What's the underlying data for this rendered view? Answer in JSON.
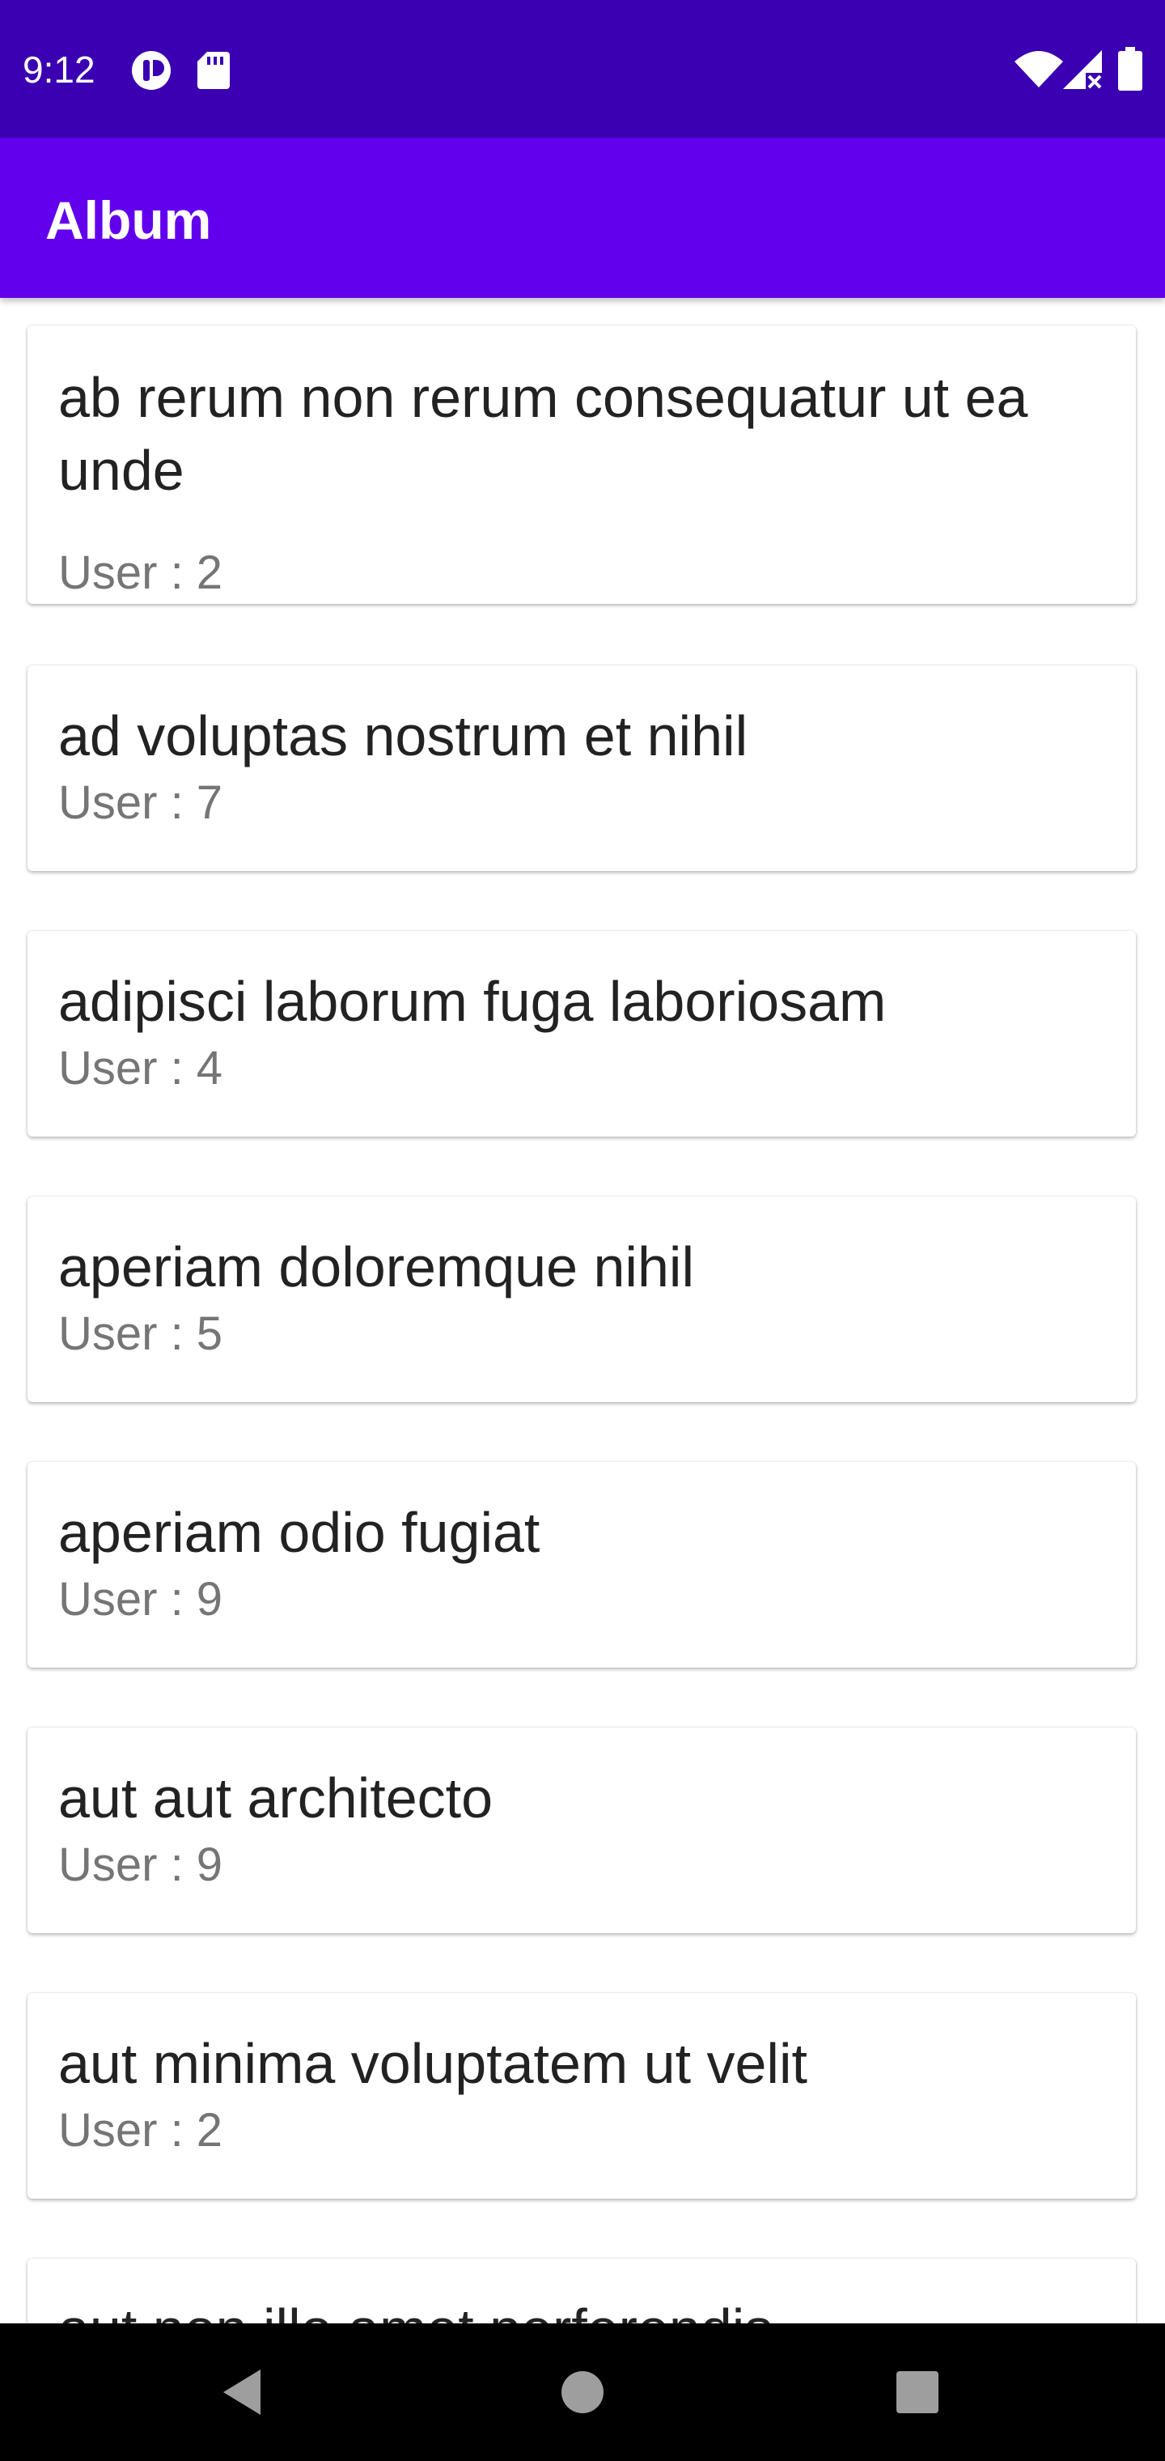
{
  "status_bar": {
    "time": "9:12",
    "left_icons": [
      "notification-app-icon",
      "sd-card-icon"
    ],
    "right_icons": [
      "wifi-icon",
      "cellular-signal-icon",
      "battery-icon"
    ]
  },
  "app_bar": {
    "title": "Album"
  },
  "albums": [
    {
      "title": "ab rerum non rerum consequatur ut ea unde",
      "user": "User : 2"
    },
    {
      "title": "ad voluptas nostrum et nihil",
      "user": "User : 7"
    },
    {
      "title": "adipisci laborum fuga laboriosam",
      "user": "User : 4"
    },
    {
      "title": "aperiam doloremque nihil",
      "user": "User : 5"
    },
    {
      "title": "aperiam odio fugiat",
      "user": "User : 9"
    },
    {
      "title": "aut aut architecto",
      "user": "User : 9"
    },
    {
      "title": "aut minima voluptatem ut velit",
      "user": "User : 2"
    },
    {
      "title": "aut non illo amet perferendis"
    }
  ],
  "nav_bar": {
    "buttons": [
      "back-icon",
      "home-icon",
      "recents-icon"
    ]
  },
  "colors": {
    "status_bar": "#3a00b1",
    "app_bar": "#6200ee",
    "title_text": "#222222",
    "user_text": "#757575"
  }
}
